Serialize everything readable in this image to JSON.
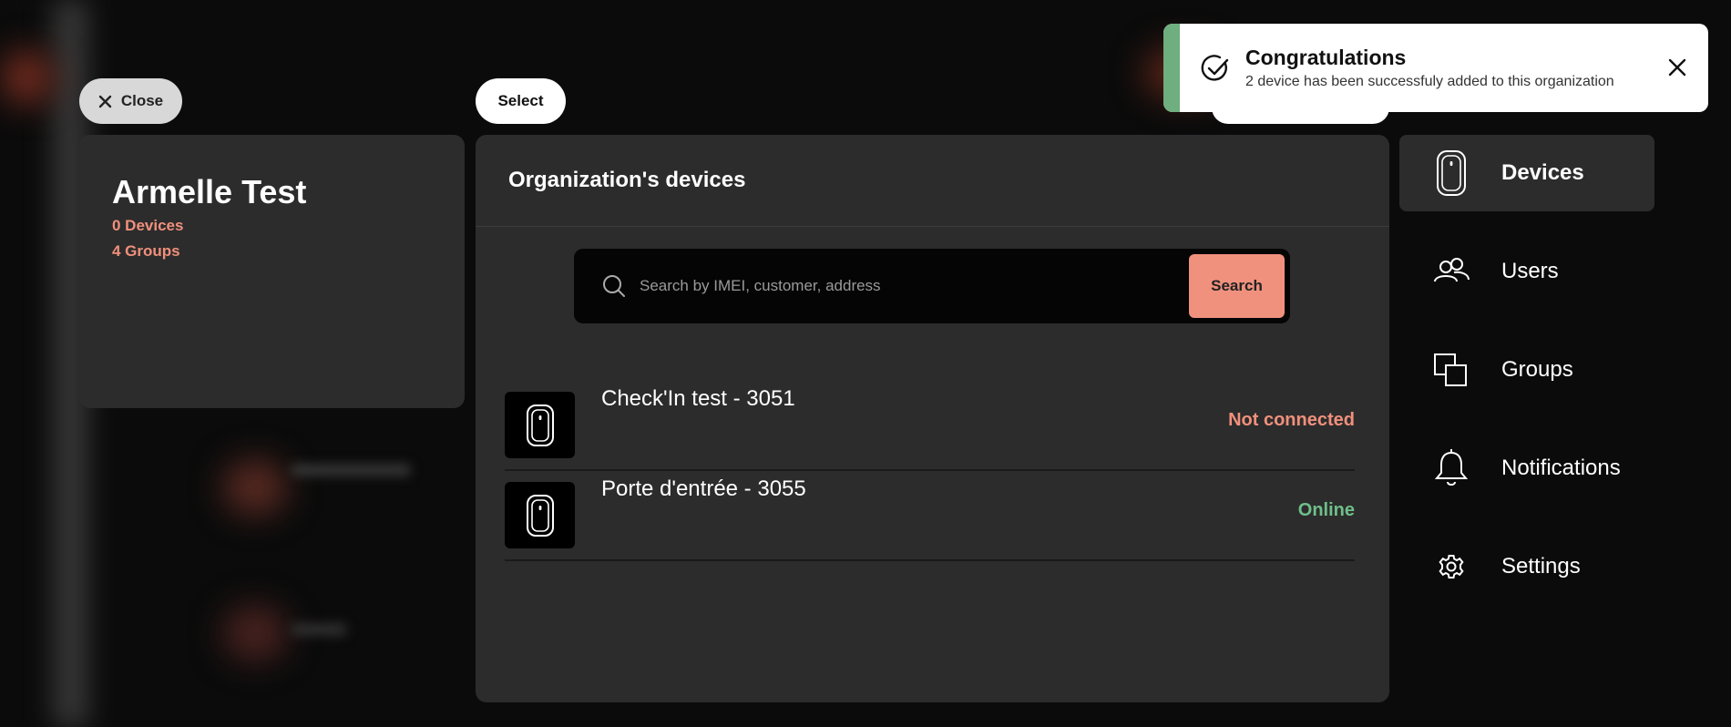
{
  "toolbar": {
    "close_label": "Close",
    "select_label": "Select"
  },
  "organization": {
    "name": "Armelle Test",
    "devices_count": "0 Devices",
    "groups_count": "4 Groups"
  },
  "devices_panel": {
    "title": "Organization's devices",
    "search": {
      "placeholder": "Search by IMEI, customer, address",
      "button_label": "Search"
    },
    "devices": [
      {
        "name": "Check'In test - 3051",
        "status": "Not connected",
        "status_color": "#f0907c"
      },
      {
        "name": "Porte d'entrée - 3055",
        "status": "Online",
        "status_color": "#6fbf8a"
      }
    ]
  },
  "nav": {
    "items": [
      {
        "label": "Devices",
        "icon": "device-icon",
        "active": true
      },
      {
        "label": "Users",
        "icon": "users-icon"
      },
      {
        "label": "Groups",
        "icon": "groups-icon"
      },
      {
        "label": "Notifications",
        "icon": "bell-icon"
      },
      {
        "label": "Settings",
        "icon": "gear-icon"
      }
    ]
  },
  "toast": {
    "title": "Congratulations",
    "message": "2 device has been successfuly added to this organization",
    "icon": "check-circle-icon",
    "accent_color": "#6fae7e"
  },
  "colors": {
    "accent": "#f0917e",
    "panel": "#2c2c2c",
    "background": "#0b0b0b"
  }
}
